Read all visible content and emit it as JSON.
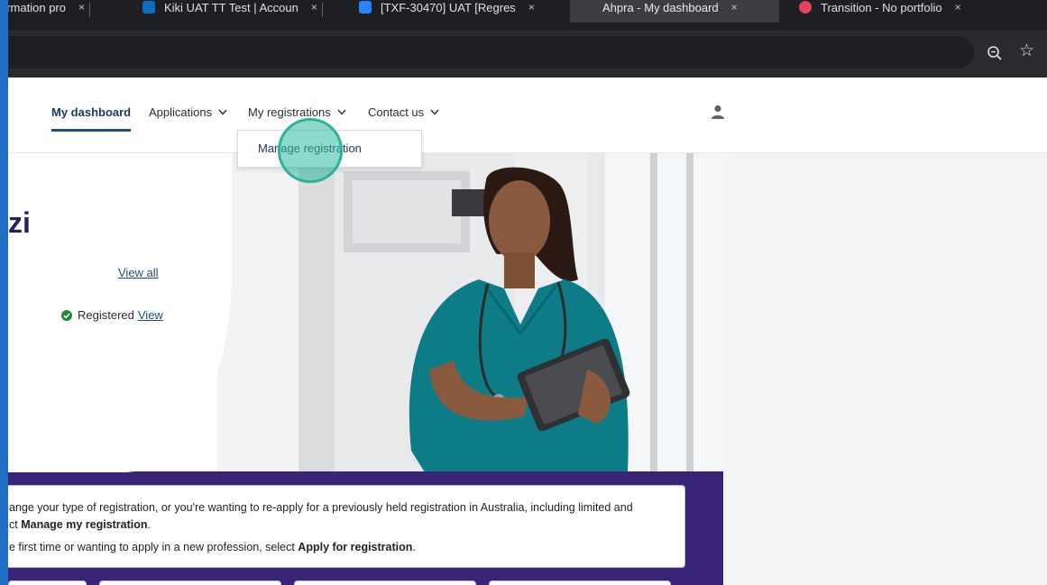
{
  "browser": {
    "tabs": [
      {
        "label": "ormation pro",
        "active": false
      },
      {
        "label": "Kiki UAT TT Test | Accoun",
        "active": false
      },
      {
        "label": "[TXF-30470] UAT [Regres",
        "active": false
      },
      {
        "label": "Ahpra - My dashboard",
        "active": true
      },
      {
        "label": "Transition - No portfolio",
        "active": false
      }
    ],
    "tab_close_glyph": "×",
    "toolbar": {
      "zoom_icon": "zoom-out-icon",
      "bookmark_icon": "star-icon",
      "bookmark_glyph": "☆"
    }
  },
  "nav": {
    "items": [
      {
        "label": "My dashboard",
        "active": true,
        "has_chevron": false
      },
      {
        "label": "Applications",
        "has_chevron": true
      },
      {
        "label": "My registrations",
        "has_chevron": true
      },
      {
        "label": "Contact us",
        "has_chevron": true
      }
    ],
    "user_icon": "user-icon"
  },
  "dropdown": {
    "items": [
      {
        "label": "Manage registration"
      }
    ]
  },
  "hero": {
    "greeting": "zi",
    "view_all": "View all",
    "status": {
      "label": "Registered",
      "link": "View",
      "icon": "check-circle-icon"
    }
  },
  "info": {
    "line1": "ange your type of registration, or you're wanting to re-apply for a previously held registration in Australia, including limited and",
    "line2_prefix": "ct ",
    "line2_bold": "Manage my registration",
    "line2_suffix": ".",
    "line3_prefix": "e first time or wanting to apply in a new profession, select ",
    "line3_bold": "Apply for registration",
    "line3_suffix": "."
  },
  "colors": {
    "brand_purple": "#3a2478",
    "nav_active": "#1b4f7d",
    "click_marker": "#2fbaa0",
    "status_green": "#1f8a3c"
  }
}
